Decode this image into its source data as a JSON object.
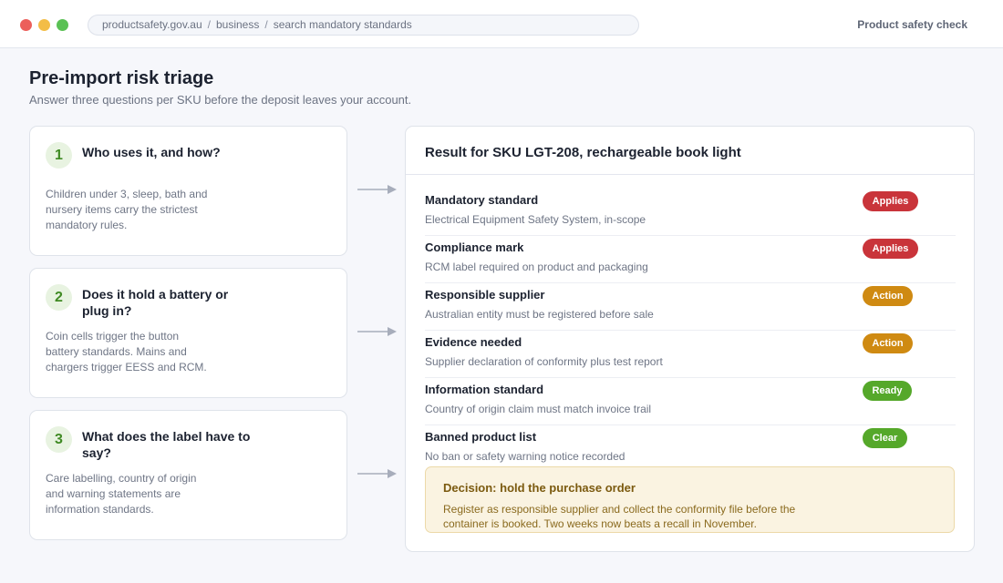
{
  "window": {
    "breadcrumb": [
      "productsafety.gov.au",
      "business",
      "search mandatory standards"
    ],
    "separator": "/",
    "app_title": "Product safety check"
  },
  "header": {
    "title": "Pre-import risk triage",
    "subtitle": "Answer three questions per SKU before the deposit leaves your account."
  },
  "steps": [
    {
      "number": "1",
      "question": "Who uses it, and how?",
      "body": "Children under 3, sleep, bath and nursery items carry the strictest mandatory rules."
    },
    {
      "number": "2",
      "question": "Does it hold a battery or plug in?",
      "body": "Coin cells trigger the button battery standards. Mains and chargers trigger EESS and RCM."
    },
    {
      "number": "3",
      "question": "What does the label have to say?",
      "body": "Care labelling, country of origin and warning statements are information standards."
    }
  ],
  "result": {
    "title": "Result for SKU LGT-208, rechargeable book light",
    "rows": [
      {
        "label": "Mandatory standard",
        "detail": "Electrical Equipment Safety System, in-scope",
        "status": "Applies",
        "kind": "applies"
      },
      {
        "label": "Compliance mark",
        "detail": "RCM label required on product and packaging",
        "status": "Applies",
        "kind": "applies"
      },
      {
        "label": "Responsible supplier",
        "detail": "Australian entity must be registered before sale",
        "status": "Action",
        "kind": "action"
      },
      {
        "label": "Evidence needed",
        "detail": "Supplier declaration of conformity plus test report",
        "status": "Action",
        "kind": "action"
      },
      {
        "label": "Information standard",
        "detail": "Country of origin claim must match invoice trail",
        "status": "Ready",
        "kind": "ready"
      },
      {
        "label": "Banned product list",
        "detail": "No ban or safety warning notice recorded",
        "status": "Clear",
        "kind": "clear"
      }
    ],
    "decision": {
      "title": "Decision: hold the purchase order",
      "body": "Register as responsible supplier and collect the conformity file before the container is booked. Two weeks now beats a recall in November."
    }
  },
  "colors": {
    "applies": "#c9343a",
    "action": "#cf8a12",
    "ready": "#55a82a",
    "clear": "#55a82a",
    "step_accent": "#3f8a23",
    "decision_bg": "#faf3e1"
  }
}
